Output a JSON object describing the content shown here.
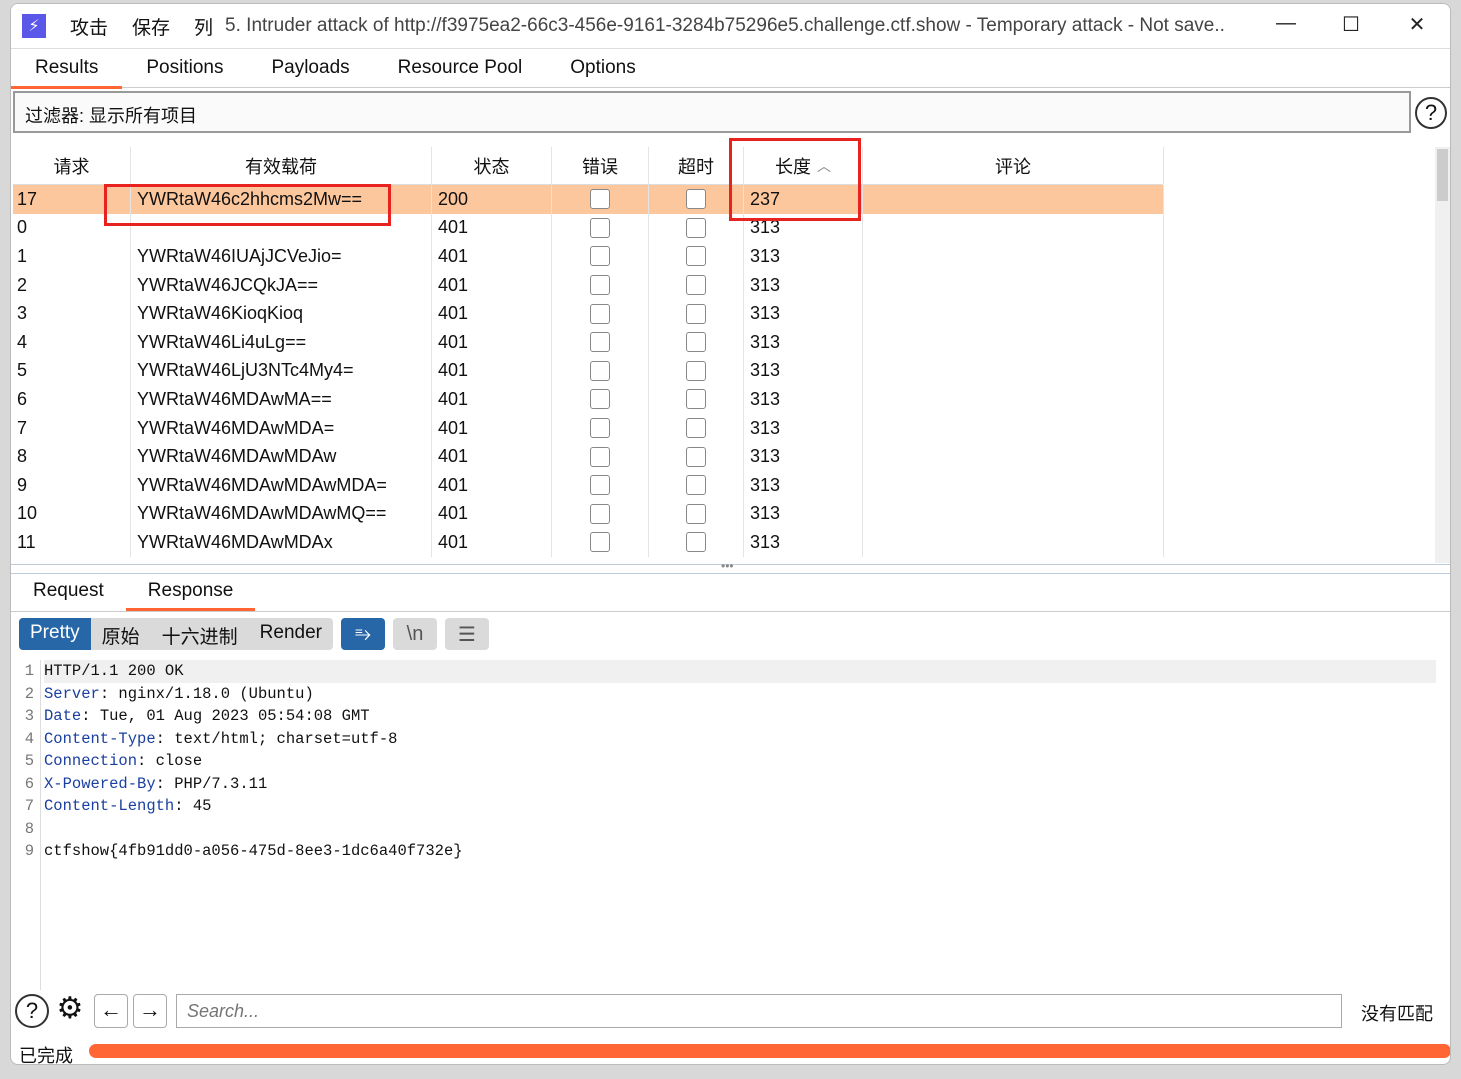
{
  "titlebar": {
    "menu": [
      "攻击",
      "保存",
      "列"
    ],
    "title": "5. Intruder attack of http://f3975ea2-66c3-456e-9161-3284b75296e5.challenge.ctf.show - Temporary attack - Not save..",
    "controls": [
      "minimize",
      "maximize",
      "close"
    ]
  },
  "tabs": [
    {
      "label": "Results",
      "active": true
    },
    {
      "label": "Positions"
    },
    {
      "label": "Payloads"
    },
    {
      "label": "Resource Pool"
    },
    {
      "label": "Options"
    }
  ],
  "filter": {
    "text": "过滤器: 显示所有项目"
  },
  "table": {
    "columns": [
      "请求",
      "有效载荷",
      "状态",
      "错误",
      "超时",
      "长度",
      "评论"
    ],
    "sort": {
      "column": "长度",
      "direction": "ascending"
    },
    "rows": [
      [
        "17",
        "YWRtaW46c2hhcms2Mw==",
        "200",
        false,
        false,
        "237",
        ""
      ],
      [
        "0",
        "",
        "401",
        false,
        false,
        "313",
        ""
      ],
      [
        "1",
        "YWRtaW46IUAjJCVeJio=",
        "401",
        false,
        false,
        "313",
        ""
      ],
      [
        "2",
        "YWRtaW46JCQkJA==",
        "401",
        false,
        false,
        "313",
        ""
      ],
      [
        "3",
        "YWRtaW46KioqKioq",
        "401",
        false,
        false,
        "313",
        ""
      ],
      [
        "4",
        "YWRtaW46Li4uLg==",
        "401",
        false,
        false,
        "313",
        ""
      ],
      [
        "5",
        "YWRtaW46LjU3NTc4My4=",
        "401",
        false,
        false,
        "313",
        ""
      ],
      [
        "6",
        "YWRtaW46MDAwMA==",
        "401",
        false,
        false,
        "313",
        ""
      ],
      [
        "7",
        "YWRtaW46MDAwMDA=",
        "401",
        false,
        false,
        "313",
        ""
      ],
      [
        "8",
        "YWRtaW46MDAwMDAw",
        "401",
        false,
        false,
        "313",
        ""
      ],
      [
        "9",
        "YWRtaW46MDAwMDAwMDA=",
        "401",
        false,
        false,
        "313",
        ""
      ],
      [
        "10",
        "YWRtaW46MDAwMDAwMQ==",
        "401",
        false,
        false,
        "313",
        ""
      ],
      [
        "11",
        "YWRtaW46MDAwMDAx",
        "401",
        false,
        false,
        "313",
        ""
      ]
    ],
    "selected_row": 0
  },
  "response_tabs": [
    {
      "label": "Request"
    },
    {
      "label": "Response",
      "active": true
    }
  ],
  "view_modes": [
    {
      "label": "Pretty",
      "active": true
    },
    {
      "label": "原始"
    },
    {
      "label": "十六进制"
    },
    {
      "label": "Render"
    }
  ],
  "view_icons": [
    "wrap-icon",
    "newline-icon",
    "menu-icon"
  ],
  "response_lines": [
    {
      "n": "1",
      "key": "",
      "val": "HTTP/1.1 200 OK"
    },
    {
      "n": "2",
      "key": "Server",
      "val": ": nginx/1.18.0 (Ubuntu)"
    },
    {
      "n": "3",
      "key": "Date",
      "val": ": Tue, 01 Aug 2023 05:54:08 GMT"
    },
    {
      "n": "4",
      "key": "Content-Type",
      "val": ": text/html; charset=utf-8"
    },
    {
      "n": "5",
      "key": "Connection",
      "val": ": close"
    },
    {
      "n": "6",
      "key": "X-Powered-By",
      "val": ": PHP/7.3.11"
    },
    {
      "n": "7",
      "key": "Content-Length",
      "val": ": 45"
    },
    {
      "n": "8",
      "key": "",
      "val": ""
    },
    {
      "n": "9",
      "key": "",
      "val": "ctfshow{4fb91dd0-a056-475d-8ee3-1dc6a40f732e}"
    }
  ],
  "search": {
    "placeholder": "Search...",
    "result": "没有匹配"
  },
  "status": {
    "text": "已完成",
    "progress": 100,
    "color": "#ff6633"
  }
}
